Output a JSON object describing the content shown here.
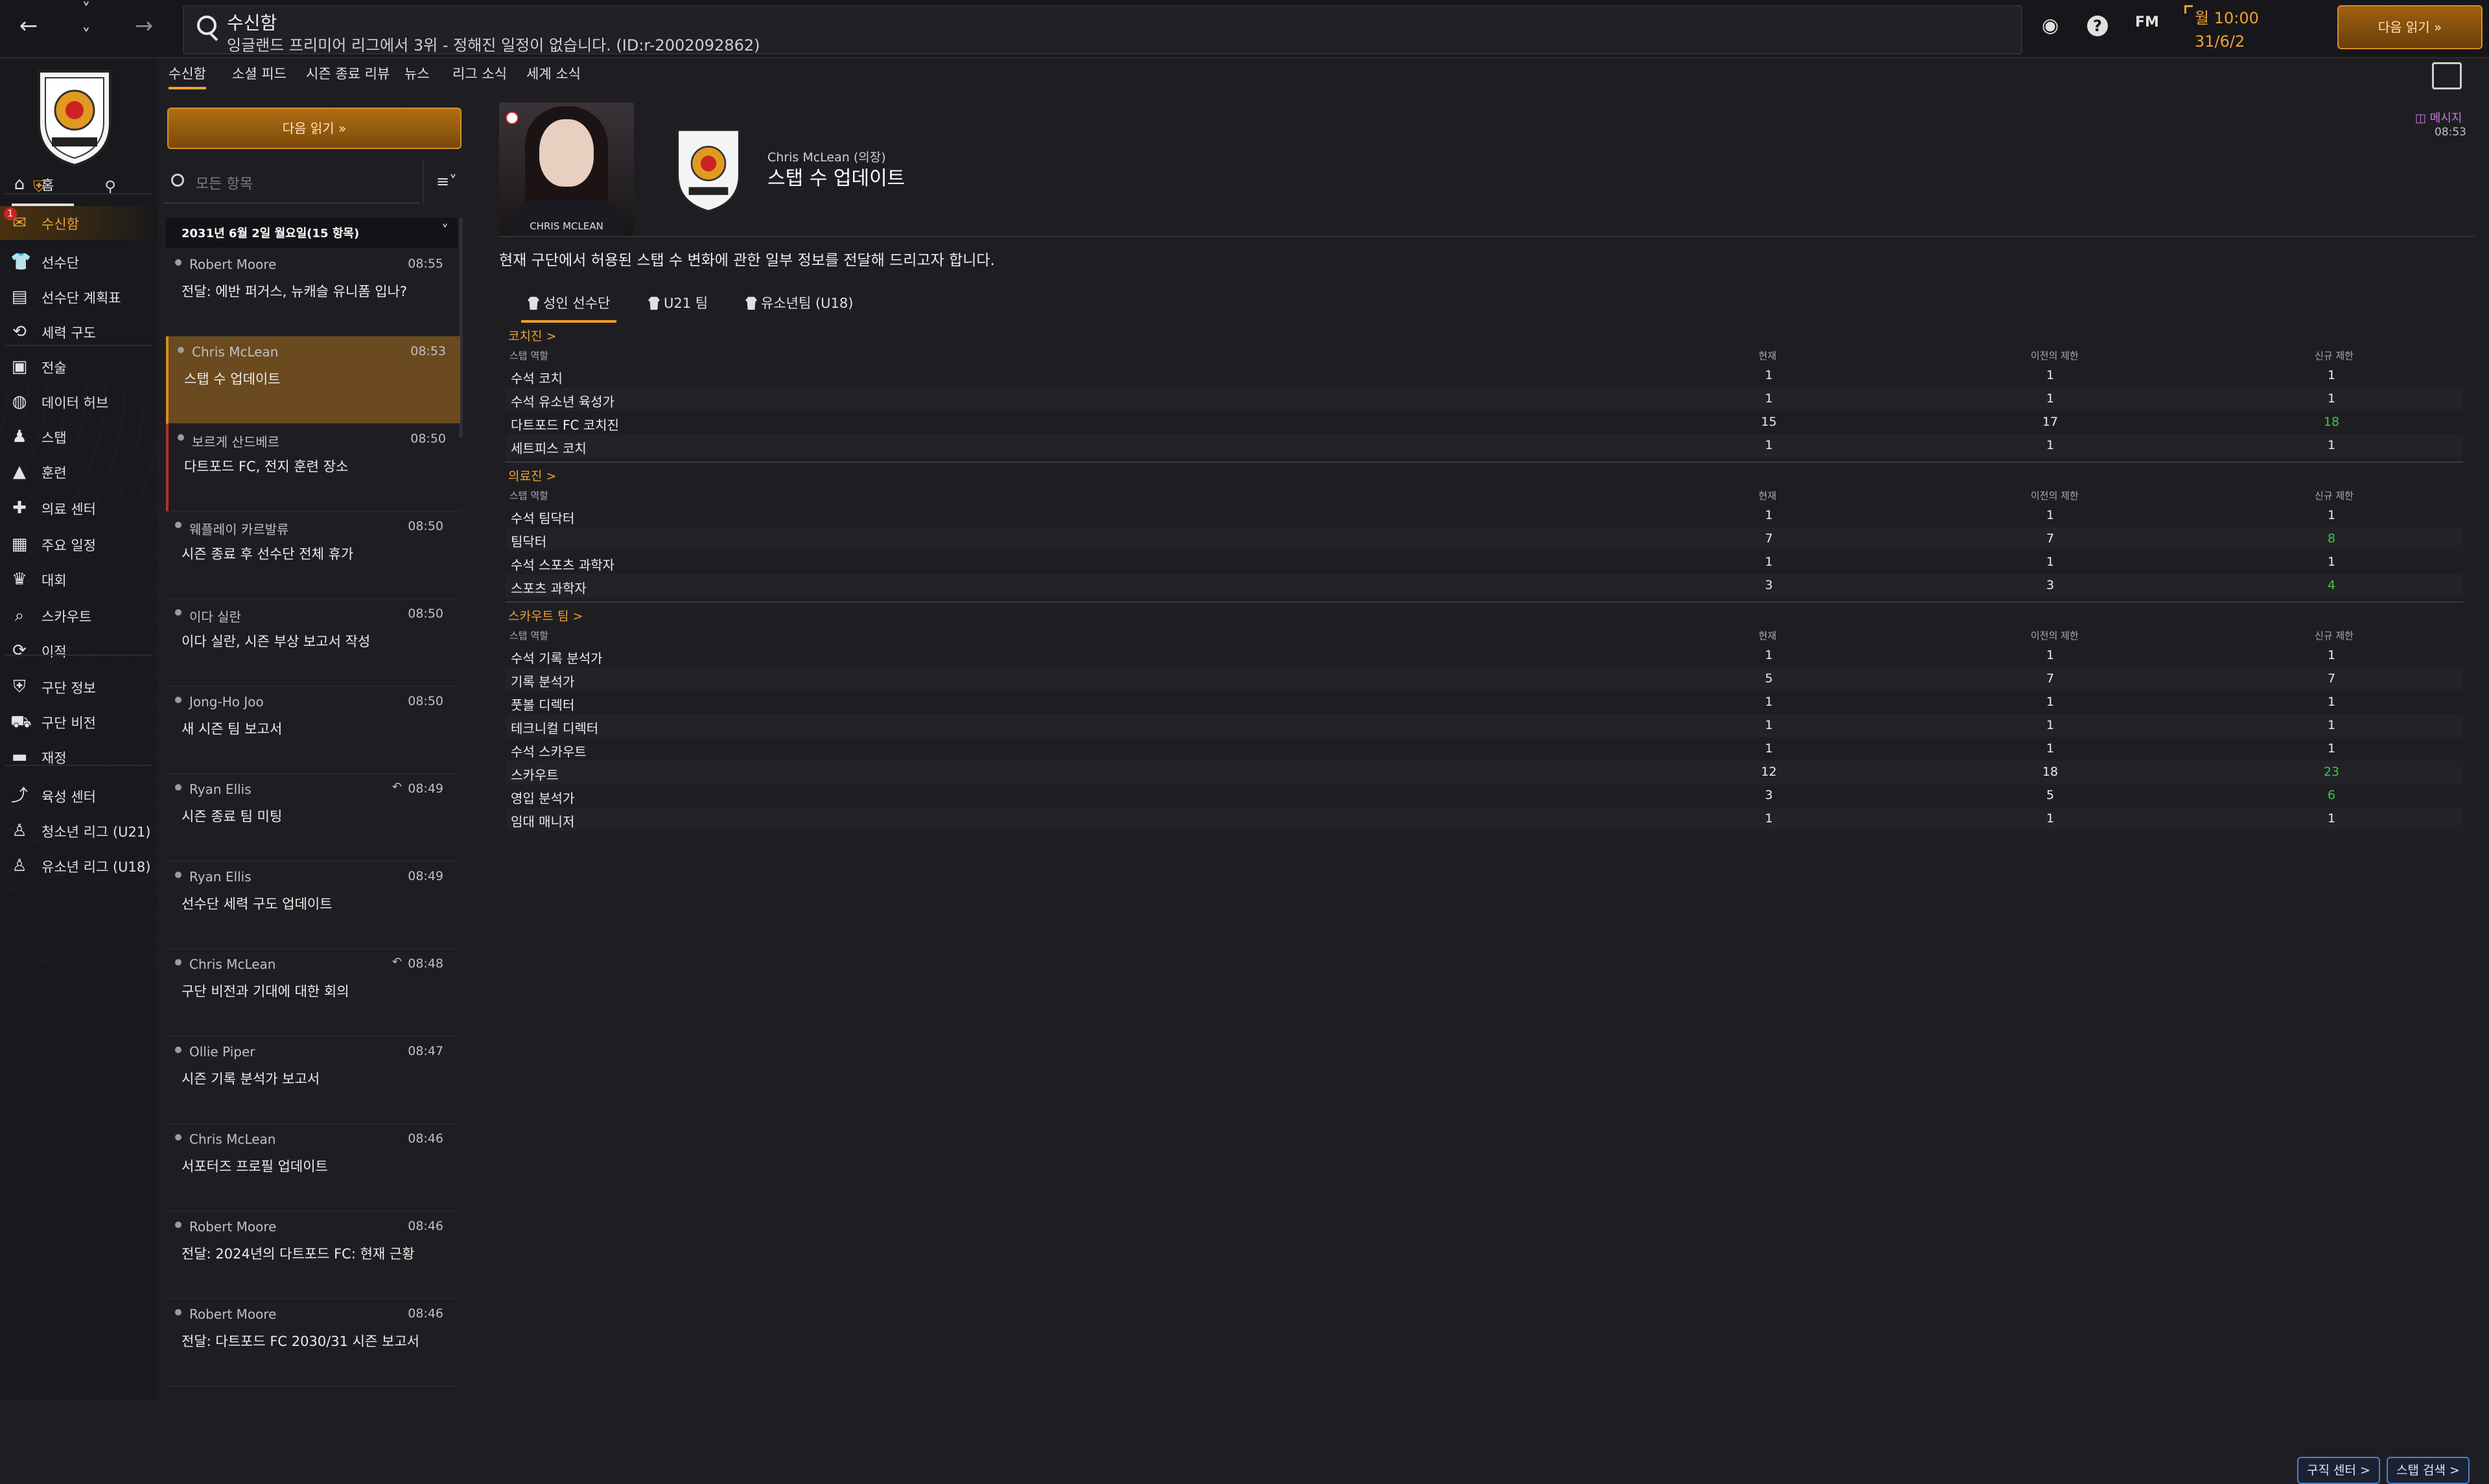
{
  "header": {
    "title": "수신함",
    "subtitle": "잉글랜드 프리미어 리그에서 3위 - 정해진 일정이 없습니다. (ID:r-2002092862)",
    "fm_label": "FM",
    "day_time": "월 10:00",
    "date": "31/6/2",
    "continue_label": "다음 읽기"
  },
  "sidebar": {
    "items": [
      {
        "label": "홈",
        "icon": "home-icon"
      },
      {
        "label": "수신함",
        "icon": "inbox-icon",
        "active": true,
        "badge": "1"
      },
      {
        "label": "선수단",
        "icon": "shirt-icon"
      },
      {
        "label": "선수단 계획표",
        "icon": "clipboard-icon"
      },
      {
        "label": "세력 구도",
        "icon": "dynamics-icon"
      },
      {
        "label": "전술",
        "icon": "tactics-icon"
      },
      {
        "label": "데이터 허브",
        "icon": "data-hub-icon"
      },
      {
        "label": "스탭",
        "icon": "staff-icon"
      },
      {
        "label": "훈련",
        "icon": "training-icon"
      },
      {
        "label": "의료 센터",
        "icon": "medical-icon"
      },
      {
        "label": "주요 일정",
        "icon": "calendar-icon"
      },
      {
        "label": "대회",
        "icon": "trophy-icon"
      },
      {
        "label": "스카우트",
        "icon": "scout-icon"
      },
      {
        "label": "이적",
        "icon": "transfer-icon"
      },
      {
        "label": "구단 정보",
        "icon": "shield-icon"
      },
      {
        "label": "구단 비전",
        "icon": "vision-icon"
      },
      {
        "label": "재정",
        "icon": "finance-icon"
      },
      {
        "label": "육성 센터",
        "icon": "development-icon"
      },
      {
        "label": "청소년 리그 (U21)",
        "icon": "u21-icon"
      },
      {
        "label": "유소년 리그 (U18)",
        "icon": "u18-icon"
      }
    ]
  },
  "subtabs": [
    "수신함",
    "소셜 피드",
    "시즌 종료 리뷰",
    "뉴스",
    "리그 소식",
    "세계 소식"
  ],
  "inbox": {
    "continue_label": "다음 읽기",
    "filter_placeholder": "모든 항목",
    "date_header": "2031년 6월 2일 월요일(15 항목)",
    "messages": [
      {
        "sender": "Robert Moore",
        "time": "08:55",
        "subject": "전달: 에반 퍼거스, 뉴캐슬 유니폼 입나?"
      },
      {
        "sender": "Chris McLean",
        "time": "08:53",
        "subject": "스탭 수 업데이트",
        "selected": true
      },
      {
        "sender": "보르게 산드베르",
        "time": "08:50",
        "subject": "다트포드 FC, 전지 훈련 장소"
      },
      {
        "sender": "웨플레이 카르발류",
        "time": "08:50",
        "subject": "시즌 종료 후 선수단 전체 휴가"
      },
      {
        "sender": "이다 실란",
        "time": "08:50",
        "subject": "이다 실란, 시즌 부상 보고서 작성"
      },
      {
        "sender": "Jong-Ho Joo",
        "time": "08:50",
        "subject": "새 시즌 팀 보고서"
      },
      {
        "sender": "Ryan Ellis",
        "time": "08:49",
        "subject": "시즌 종료 팀 미팅",
        "reply": true
      },
      {
        "sender": "Ryan Ellis",
        "time": "08:49",
        "subject": "선수단 세력 구도 업데이트"
      },
      {
        "sender": "Chris McLean",
        "time": "08:48",
        "subject": "구단 비전과 기대에 대한 회의",
        "reply": true
      },
      {
        "sender": "Ollie Piper",
        "time": "08:47",
        "subject": "시즌 기록 분석가 보고서"
      },
      {
        "sender": "Chris McLean",
        "time": "08:46",
        "subject": "서포터즈 프로필 업데이트"
      },
      {
        "sender": "Robert Moore",
        "time": "08:46",
        "subject": "전달: 2024년의 다트포드 FC: 현재 근황"
      },
      {
        "sender": "Robert Moore",
        "time": "08:46",
        "subject": "전달: 다트포드 FC 2030/31 시즌 보고서"
      }
    ]
  },
  "detail": {
    "photo_caption": "CHRIS MCLEAN",
    "from": "Chris McLean (의장)",
    "title": "스탭 수 업데이트",
    "tag": "메시지",
    "time": "08:53",
    "body": "현재 구단에서 허용된 스탭 수 변화에 관한 일부 정보를 전달해 드리고자 합니다.",
    "squad_tabs": [
      "성인 선수단",
      "U21 팀",
      "유소년팀 (U18)"
    ],
    "col_role": "스탭 역할",
    "col_current": "현재",
    "col_prev": "이전의 제한",
    "col_new": "신규 제한",
    "groups": [
      {
        "title": "코치진 >",
        "rows": [
          {
            "role": "수석 코치",
            "current": "1",
            "prev": "1",
            "new": "1",
            "up": false
          },
          {
            "role": "수석 유소년 육성가",
            "current": "1",
            "prev": "1",
            "new": "1",
            "up": false
          },
          {
            "role": "다트포드 FC 코치진",
            "current": "15",
            "prev": "17",
            "new": "18",
            "up": true
          },
          {
            "role": "세트피스 코치",
            "current": "1",
            "prev": "1",
            "new": "1",
            "up": false
          }
        ]
      },
      {
        "title": "의료진 >",
        "rows": [
          {
            "role": "수석 팀닥터",
            "current": "1",
            "prev": "1",
            "new": "1",
            "up": false
          },
          {
            "role": "팀닥터",
            "current": "7",
            "prev": "7",
            "new": "8",
            "up": true
          },
          {
            "role": "수석 스포츠 과학자",
            "current": "1",
            "prev": "1",
            "new": "1",
            "up": false
          },
          {
            "role": "스포츠 과학자",
            "current": "3",
            "prev": "3",
            "new": "4",
            "up": true
          }
        ]
      },
      {
        "title": "스카우트 팀 >",
        "rows": [
          {
            "role": "수석 기록 분석가",
            "current": "1",
            "prev": "1",
            "new": "1",
            "up": false
          },
          {
            "role": "기록 분석가",
            "current": "5",
            "prev": "7",
            "new": "7",
            "up": false
          },
          {
            "role": "풋볼 디렉터",
            "current": "1",
            "prev": "1",
            "new": "1",
            "up": false
          },
          {
            "role": "테크니컬 디렉터",
            "current": "1",
            "prev": "1",
            "new": "1",
            "up": false
          },
          {
            "role": "수석 스카우트",
            "current": "1",
            "prev": "1",
            "new": "1",
            "up": false
          },
          {
            "role": "스카우트",
            "current": "12",
            "prev": "18",
            "new": "23",
            "up": true
          },
          {
            "role": "영입 분석가",
            "current": "3",
            "prev": "5",
            "new": "6",
            "up": true
          },
          {
            "role": "임대 매니저",
            "current": "1",
            "prev": "1",
            "new": "1",
            "up": false
          }
        ]
      }
    ],
    "btn_jobs": "구직 센터 >",
    "btn_staff": "스탭 검색 >"
  }
}
